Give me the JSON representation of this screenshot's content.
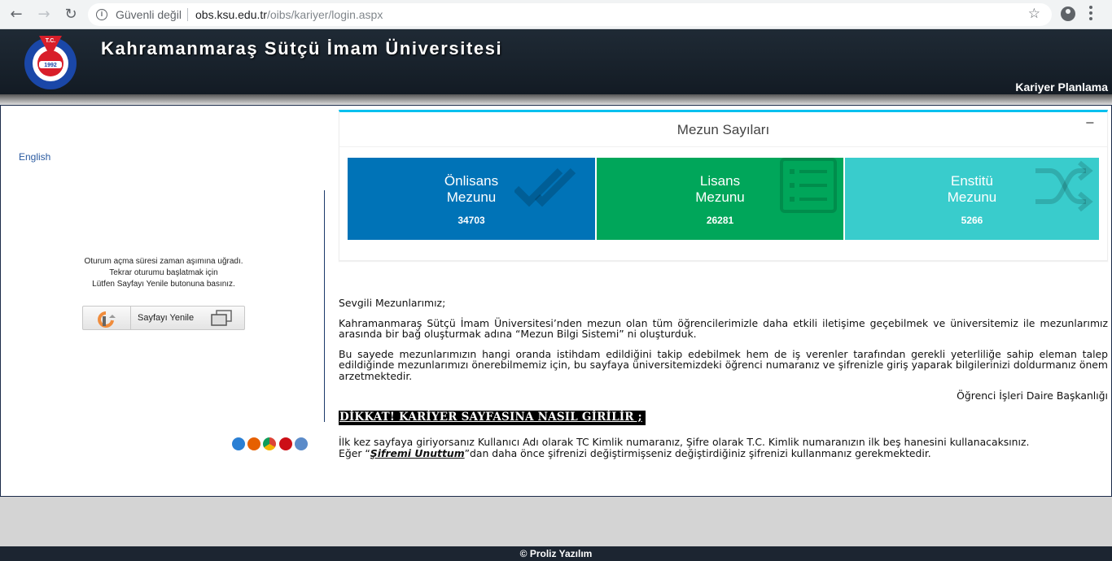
{
  "browser": {
    "back_icon": "arrow-left-icon",
    "forward_icon": "arrow-right-icon",
    "reload_icon": "reload-icon",
    "security_label": "Güvenli değil",
    "url_host": "obs.ksu.edu.tr",
    "url_path": "/oibs/kariyer/login.aspx"
  },
  "header": {
    "logo_text": "T.C.",
    "logo_year": "1992",
    "title": "Kahramanmaraş Sütçü İmam Üniversitesi",
    "section": "Kariyer Planlama"
  },
  "sidebar": {
    "language_link": "English",
    "timeout_line1": "Oturum açma süresi zaman aşımına uğradı.",
    "timeout_line2": "Tekrar oturumu başlatmak için",
    "timeout_line3": "Lütfen Sayfayı Yenile butonuna basınız.",
    "refresh_button": "Sayfayı Yenile"
  },
  "stats": {
    "title": "Mezun Sayıları",
    "collapse_label": "−",
    "tiles": [
      {
        "line1": "Önlisans",
        "line2": "Mezunu",
        "value": "34703",
        "color": "#0073b7"
      },
      {
        "line1": "Lisans",
        "line2": "Mezunu",
        "value": "26281",
        "color": "#00a65a"
      },
      {
        "line1": "Enstitü",
        "line2": "Mezunu",
        "value": "5266",
        "color": "#39cccc"
      }
    ]
  },
  "content": {
    "greeting": "Sevgili Mezunlarımız;",
    "para1": "Kahramanmaraş Sütçü İmam Üniversitesi’nden mezun olan tüm öğrencilerimizle daha etkili iletişime geçebilmek ve üniversitemiz ile mezunlarımız arasında bir bağ oluşturmak adına “Mezun Bilgi Sistemi” ni oluşturduk.",
    "para2": "Bu sayede mezunlarımızın hangi oranda istihdam edildiğini takip edebilmek hem de iş verenler tarafından gerekli yeterliliğe sahip eleman talep edildiğinde mezunlarımızı önerebilmemiz için, bu sayfaya üniversitemizdeki öğrenci numaranız ve şifrenizle giriş yaparak bilgilerinizi doldurmanız önem arzetmektedir.",
    "signature": "Öğrenci İşleri Daire Başkanlığı",
    "warning": "DİKKAT! KARİYER SAYFASINA NASIL GİRİLİR ;",
    "info1": "İlk kez sayfaya giriyorsanız Kullanıcı Adı olarak TC Kimlik numaranız, Şifre olarak T.C. Kimlik numaranızın ilk beş hanesini kullanacaksınız.",
    "info2_prefix": "Eğer “",
    "info2_link": "Şifremi Unuttum",
    "info2_suffix": "”dan daha önce şifrenizi değiştirmişseniz değiştirdiğiniz şifrenizi kullanmanız gerekmektedir."
  },
  "footer": {
    "copyright": "© Proliz Yazılım"
  }
}
